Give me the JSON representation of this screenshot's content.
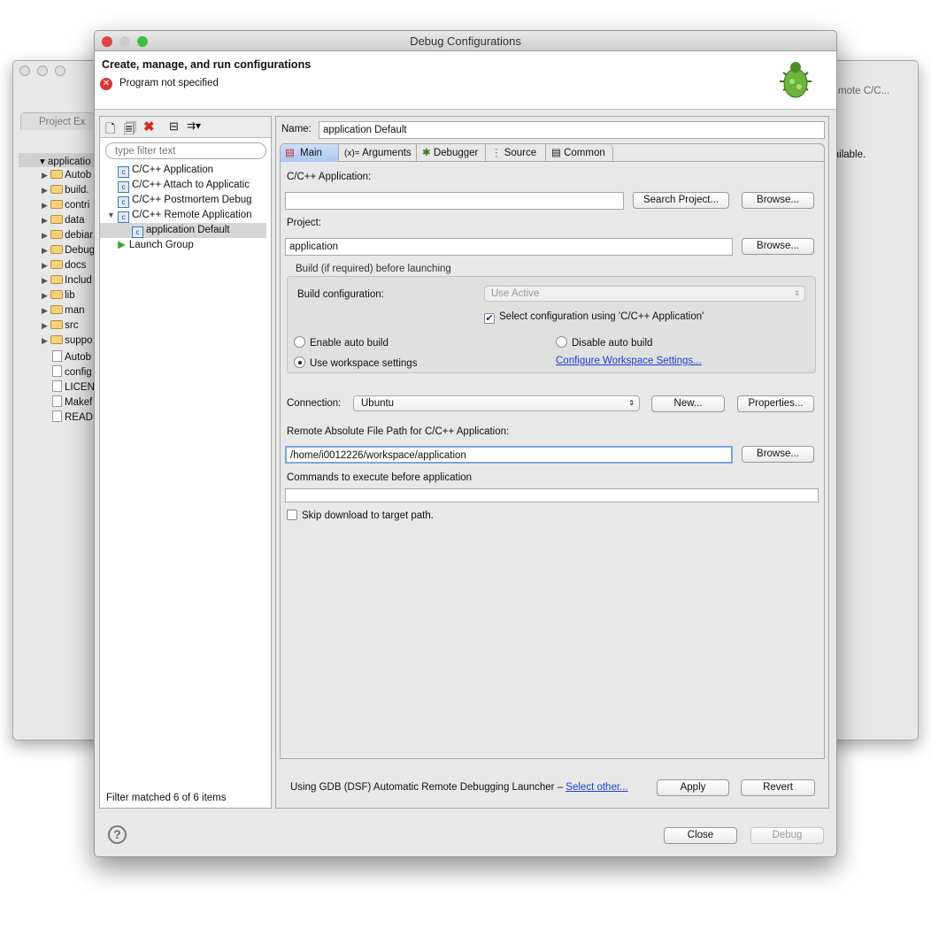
{
  "background_window": {
    "project_explorer_tab": "Project Ex",
    "root": "applicatio",
    "items": [
      "Autob",
      "build.",
      "contri",
      "data",
      "debiar",
      "Debug",
      "docs",
      "Includ",
      "lib",
      "man",
      "src",
      "suppo",
      "Autob",
      "config",
      "LICENS",
      "Makef",
      "READM"
    ],
    "right_toolbar_text": "mote C/C...",
    "right_panel_text": "vailable."
  },
  "dialog": {
    "title": "Debug Configurations",
    "header_title": "Create, manage, and run configurations",
    "error_message": "Program not specified",
    "filter_placeholder": "type filter text",
    "tree": [
      {
        "label": "C/C++ Application"
      },
      {
        "label": "C/C++ Attach to Applicatic"
      },
      {
        "label": "C/C++ Postmortem Debug"
      },
      {
        "label": "C/C++ Remote Application"
      },
      {
        "label": "application Default"
      },
      {
        "label": "Launch Group"
      }
    ],
    "filter_status": "Filter matched 6 of 6 items",
    "name_label": "Name:",
    "name_value": "application Default",
    "tabs": [
      "Main",
      "Arguments",
      "Debugger",
      "Source",
      "Common"
    ],
    "active_tab": "Main",
    "main": {
      "app_label": "C/C++ Application:",
      "app_value": "",
      "search_project": "Search Project...",
      "browse": "Browse...",
      "project_label": "Project:",
      "project_value": "application",
      "build_group": "Build (if required) before launching",
      "build_config_label": "Build configuration:",
      "build_config_value": "Use Active",
      "select_config_label": "Select configuration using 'C/C++ Application'",
      "select_config_checked": true,
      "enable_auto": "Enable auto build",
      "disable_auto": "Disable auto build",
      "use_workspace": "Use workspace settings",
      "selected_build_option": "Use workspace settings",
      "configure_link": "Configure Workspace Settings...",
      "connection_label": "Connection:",
      "connection_value": "Ubuntu",
      "new_btn": "New...",
      "properties_btn": "Properties...",
      "remote_path_label": "Remote Absolute File Path for C/C++ Application:",
      "remote_path_value": "/home/i0012226/workspace/application",
      "commands_label": "Commands to execute before application",
      "commands_value": "",
      "skip_download": "Skip download to target path.",
      "skip_download_checked": false
    },
    "launcher_text": "Using GDB (DSF) Automatic Remote Debugging Launcher –",
    "select_other": "Select other...",
    "apply": "Apply",
    "revert": "Revert",
    "close": "Close",
    "debug": "Debug"
  }
}
